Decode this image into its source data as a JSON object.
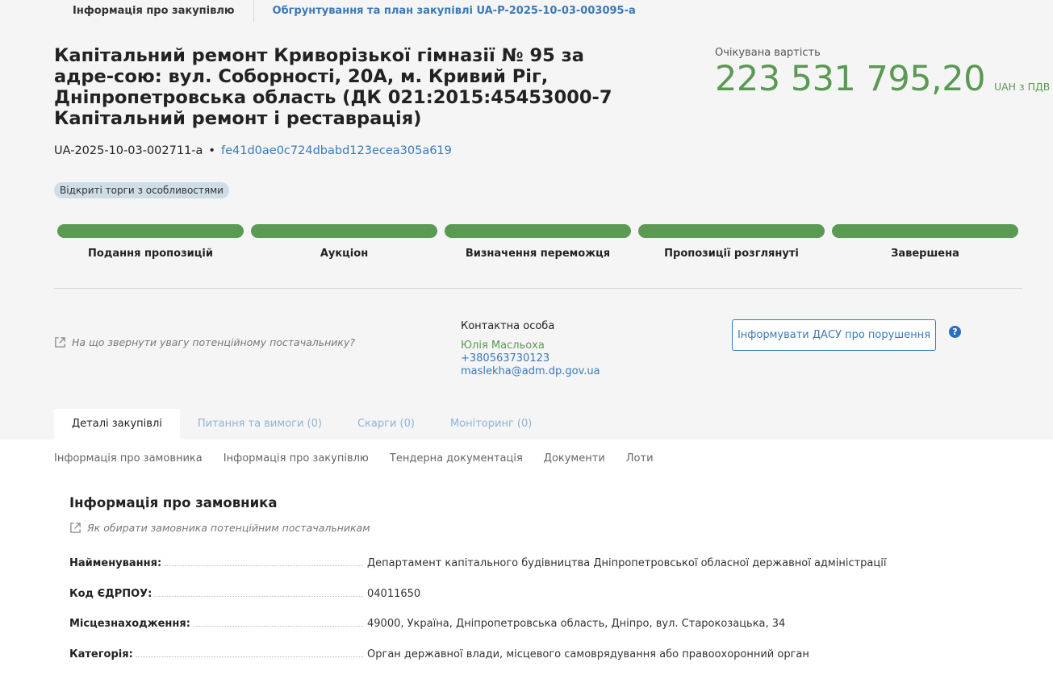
{
  "breadcrumbs": {
    "active": "Інформація про закупівлю",
    "link": "Обгрунтування та план закупівлі UA-P-2025-10-03-003095-a"
  },
  "tender": {
    "title": "Капітальний ремонт Криворізької гімназії № 95 за адре-сою: вул. Соборності, 20А, м. Кривий Ріг, Дніпропетровська область (ДК 021:2015:45453000-7 Капітальний ремонт і реставрація)",
    "id": "UA-2025-10-03-002711-a",
    "separator": "•",
    "hash": "fe41d0ae0c724dbabd123ecea305a619",
    "procedure_badge": "Відкриті торги з особливостями"
  },
  "price": {
    "label": "Очікувана вартість",
    "value": "223 531 795,20",
    "unit": "UAH з ПДВ"
  },
  "stages": [
    {
      "label": "Подання пропозицій",
      "progress": 1.0
    },
    {
      "label": "Аукціон",
      "progress": 1.0
    },
    {
      "label": "Визначення переможця",
      "progress": 1.0
    },
    {
      "label": "Пропозиції розглянуті",
      "progress": 1.0
    },
    {
      "label": "Завершена",
      "progress": 1.0
    }
  ],
  "supplier_hint": "На що звернути увагу потенційному постачальнику?",
  "contact": {
    "title": "Контактна особа",
    "name": "Юлія Масльоха",
    "phone": "+380563730123",
    "email": "maslekha@adm.dp.gov.ua"
  },
  "dasu_button": "Інформувати ДАСУ про порушення",
  "help_icon_glyph": "?",
  "tabs": [
    {
      "label": "Деталі закупівлі",
      "active": true
    },
    {
      "label": "Питання та вимоги (0)",
      "active": false
    },
    {
      "label": "Скарги (0)",
      "active": false
    },
    {
      "label": "Моніторинг (0)",
      "active": false
    }
  ],
  "subnav": [
    "Інформація про замовника",
    "Інформація про закупівлю",
    "Тендерна документація",
    "Документи",
    "Лоти"
  ],
  "customer": {
    "section_title": "Інформація про замовника",
    "hint": "Як обирати замовника потенційним постачальникам",
    "rows": [
      {
        "key": "Найменування:",
        "value": "Департамент капітального будівництва Дніпропетровської обласної державної адміністрації"
      },
      {
        "key": "Код ЄДРПОУ:",
        "value": "04011650"
      },
      {
        "key": "Місцезнаходження:",
        "value": "49000, Україна, Дніпропетровська область, Дніпро, вул. Старокозацька, 34"
      },
      {
        "key": "Категорія:",
        "value": "Орган державної влади, місцевого самоврядування або правоохоронний орган"
      }
    ]
  },
  "colors": {
    "accent_green": "#5a9a52",
    "link_blue": "#3a7ab8",
    "badge_bg": "#cfdde7",
    "header_bg": "#f5f5f5"
  },
  "icons": [
    "external-link-icon",
    "help-icon"
  ]
}
